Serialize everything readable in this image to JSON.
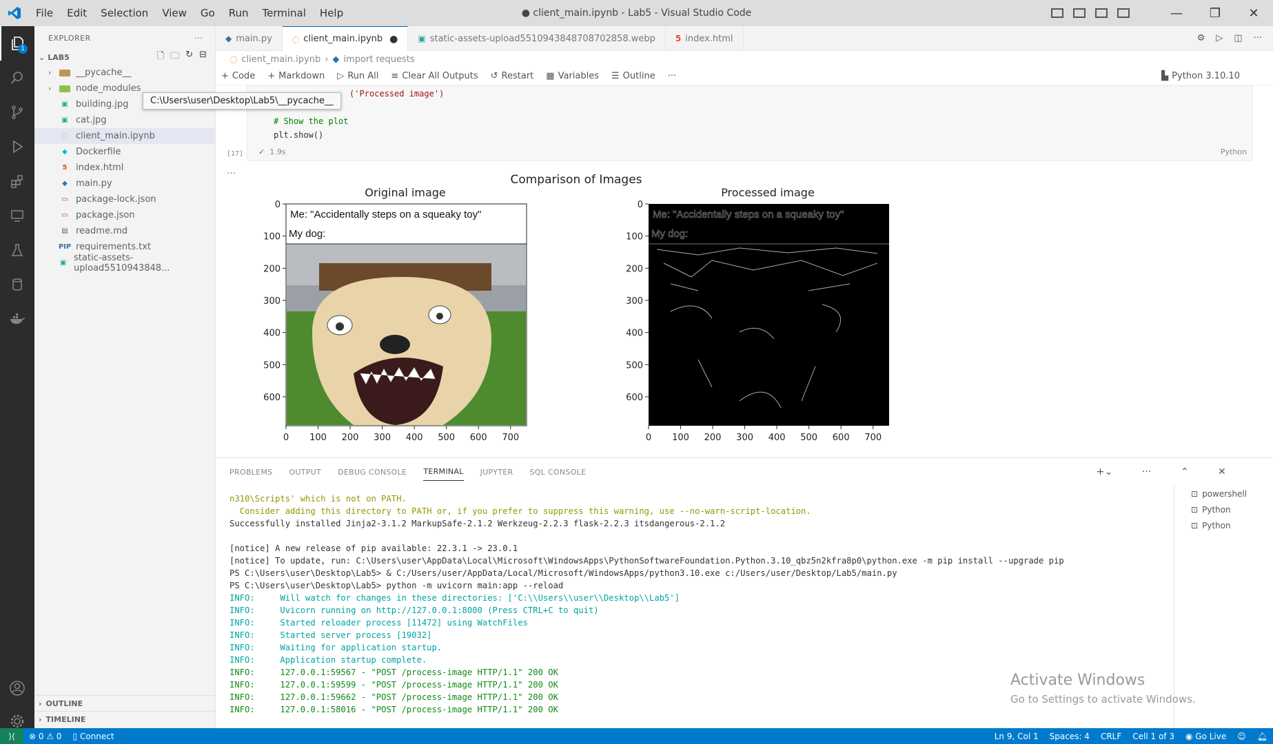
{
  "window": {
    "title": "● client_main.ipynb - Lab5 - Visual Studio Code",
    "menu": [
      "File",
      "Edit",
      "Selection",
      "View",
      "Go",
      "Run",
      "Terminal",
      "Help"
    ],
    "controls": {
      "minimize": "—",
      "maximize": "❐",
      "close": "✕"
    }
  },
  "activity_bar": {
    "items": [
      "explorer-icon",
      "search-icon",
      "source-control-icon",
      "run-debug-icon",
      "extensions-icon",
      "remote-explorer-icon",
      "testing-icon",
      "database-icon",
      "docker-icon"
    ],
    "account": "account-icon",
    "settings": "gear-icon",
    "badge": "1"
  },
  "sidebar": {
    "header": "EXPLORER",
    "folder": "LAB5",
    "files": [
      {
        "name": "__pycache__",
        "type": "folder",
        "icon_color": "#c09553"
      },
      {
        "name": "node_modules",
        "type": "folder",
        "icon_color": "#8bc34a"
      },
      {
        "name": "building.jpg",
        "type": "image",
        "icon_color": "#26a69a"
      },
      {
        "name": "cat.jpg",
        "type": "image",
        "icon_color": "#26a69a"
      },
      {
        "name": "client_main.ipynb",
        "type": "notebook",
        "icon_color": "#f37726",
        "selected": true
      },
      {
        "name": "Dockerfile",
        "type": "docker",
        "icon_color": "#0db7ed"
      },
      {
        "name": "index.html",
        "type": "html",
        "icon_color": "#e44d26"
      },
      {
        "name": "main.py",
        "type": "python",
        "icon_color": "#3572a5"
      },
      {
        "name": "package-lock.json",
        "type": "json",
        "icon_color": "#cb3837"
      },
      {
        "name": "package.json",
        "type": "json",
        "icon_color": "#cb3837"
      },
      {
        "name": "readme.md",
        "type": "md",
        "icon_color": "#666666"
      },
      {
        "name": "requirements.txt",
        "type": "txt",
        "icon_color": "#3572a5"
      },
      {
        "name": "static-assets-upload5510943848...",
        "type": "image",
        "icon_color": "#26a69a"
      }
    ],
    "outline": "OUTLINE",
    "timeline": "TIMELINE",
    "tooltip": "C:\\Users\\user\\Desktop\\Lab5\\__pycache__"
  },
  "tabs": [
    {
      "label": "main.py",
      "active": false,
      "icon_color": "#3572a5"
    },
    {
      "label": "client_main.ipynb",
      "active": true,
      "modified": true,
      "icon_color": "#f37726"
    },
    {
      "label": "static-assets-upload5510943848708702858.webp",
      "active": false,
      "icon_color": "#26a69a"
    },
    {
      "label": "index.html",
      "active": false,
      "icon_color": "#e44d26"
    }
  ],
  "breadcrumb": {
    "file": "client_main.ipynb",
    "symbol": "import requests"
  },
  "notebook_toolbar": {
    "code": "Code",
    "markdown": "Markdown",
    "run_all": "Run All",
    "clear": "Clear All Outputs",
    "restart": "Restart",
    "variables": "Variables",
    "outline": "Outline",
    "more": "···",
    "kernel": "Python 3.10.10"
  },
  "cell": {
    "code_lines": [
      [
        "('Processed image')"
      ],
      [
        "# Show the plot"
      ],
      [
        "plt.show()"
      ]
    ],
    "exec_count": "[17]",
    "status": "1.9s",
    "language": "Python"
  },
  "chart_data": [
    {
      "type": "image",
      "title": "Original image",
      "xticks": [
        "0",
        "100",
        "200",
        "300",
        "400",
        "500",
        "600",
        "700"
      ],
      "yticks": [
        "0",
        "100",
        "200",
        "300",
        "400",
        "500",
        "600"
      ],
      "caption_line1": "Me: \"Accidentally steps on a squeaky toy\"",
      "caption_line2": "My dog:"
    },
    {
      "type": "image",
      "title": "Processed image",
      "xticks": [
        "0",
        "100",
        "200",
        "300",
        "400",
        "500",
        "600",
        "700"
      ],
      "yticks": [
        "0",
        "100",
        "200",
        "300",
        "400",
        "500",
        "600"
      ],
      "caption_line1": "Me: \"Accidentally steps on a squeaky toy\"",
      "caption_line2": "My dog:"
    }
  ],
  "figure_title": "Comparison of Images",
  "panel": {
    "tabs": [
      "PROBLEMS",
      "OUTPUT",
      "DEBUG CONSOLE",
      "TERMINAL",
      "JUPYTER",
      "SQL CONSOLE"
    ],
    "active": "TERMINAL",
    "terminals": [
      "powershell",
      "Python",
      "Python"
    ],
    "lines": [
      "n310\\Scripts' which is not on PATH.",
      "  Consider adding this directory to PATH or, if you prefer to suppress this warning, use --no-warn-script-location.",
      "Successfully installed Jinja2-3.1.2 MarkupSafe-2.1.2 Werkzeug-2.2.3 flask-2.2.3 itsdangerous-2.1.2",
      "",
      "[notice] A new release of pip available: 22.3.1 -> 23.0.1",
      "[notice] To update, run: C:\\Users\\user\\AppData\\Local\\Microsoft\\WindowsApps\\PythonSoftwareFoundation.Python.3.10_qbz5n2kfra8p0\\python.exe -m pip install --upgrade pip",
      "PS C:\\Users\\user\\Desktop\\Lab5> & C:/Users/user/AppData/Local/Microsoft/WindowsApps/python3.10.exe c:/Users/user/Desktop/Lab5/main.py",
      "PS C:\\Users\\user\\Desktop\\Lab5> python -m uvicorn main:app --reload",
      "INFO:     Will watch for changes in these directories: ['C:\\\\Users\\\\user\\\\Desktop\\\\Lab5']",
      "INFO:     Uvicorn running on http://127.0.0.1:8000 (Press CTRL+C to quit)",
      "INFO:     Started reloader process [11472] using WatchFiles",
      "INFO:     Started server process [19032]",
      "INFO:     Waiting for application startup.",
      "INFO:     Application startup complete.",
      "INFO:     127.0.0.1:59567 - \"POST /process-image HTTP/1.1\" 200 OK",
      "INFO:     127.0.0.1:59599 - \"POST /process-image HTTP/1.1\" 200 OK",
      "INFO:     127.0.0.1:59662 - \"POST /process-image HTTP/1.1\" 200 OK",
      "INFO:     127.0.0.1:58016 - \"POST /process-image HTTP/1.1\" 200 OK"
    ]
  },
  "watermark": {
    "line1": "Activate Windows",
    "line2": "Go to Settings to activate Windows."
  },
  "statusbar": {
    "problems": "⊗ 0 ⚠ 0",
    "connect": "Connect",
    "position": "Ln 9, Col 1",
    "spaces": "Spaces: 4",
    "eol": "CRLF",
    "cell": "Cell 1 of 3",
    "golive": "Go Live"
  }
}
